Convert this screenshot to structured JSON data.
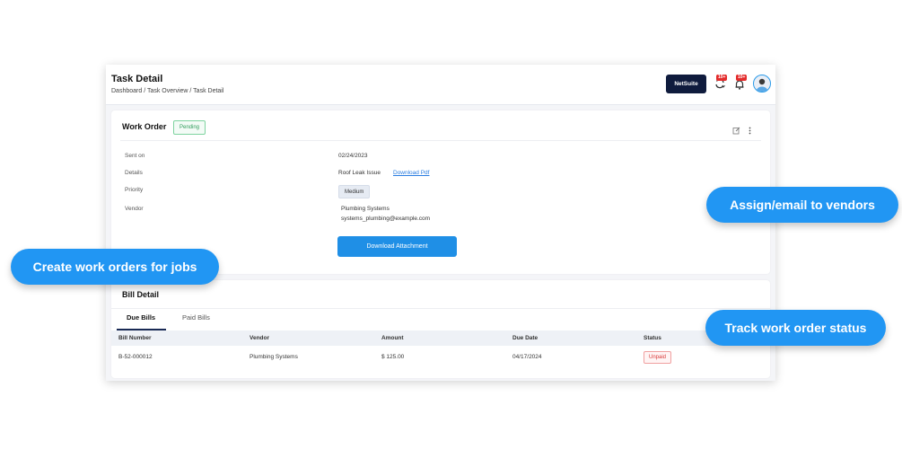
{
  "header": {
    "title": "Task Detail",
    "breadcrumb": "Dashboard / Task Overview / Task Detail",
    "netsuite_label": "NetSuite",
    "sync_badge": "10+",
    "notification_badge": "10+"
  },
  "work_order": {
    "title": "Work Order",
    "status": "Pending",
    "fields": {
      "sent_on_label": "Sent on",
      "sent_on_value": "02/24/2023",
      "details_label": "Details",
      "details_value": "Roof Leak Issue",
      "download_pdf_label": "Download Pdf",
      "priority_label": "Priority",
      "priority_value": "Medium",
      "vendor_label": "Vendor",
      "vendor_name": "Plumbing Systems",
      "vendor_email": "systems_plumbing@example.com"
    },
    "download_attachment_label": "Download Attachment"
  },
  "bill_detail": {
    "title": "Bill Detail",
    "tabs": [
      {
        "label": "Due Bills",
        "active": true
      },
      {
        "label": "Paid Bills",
        "active": false
      }
    ],
    "columns": [
      "Bill Number",
      "Vendor",
      "Amount",
      "Due Date",
      "Status"
    ],
    "rows": [
      {
        "bill_number": "B-52-000012",
        "vendor": "Plumbing Systems",
        "amount": "$ 125.00",
        "due_date": "04/17/2024",
        "status": "Unpaid"
      }
    ]
  },
  "callouts": {
    "create": "Create work orders for jobs",
    "assign": "Assign/email to vendors",
    "track": "Track work order status"
  },
  "icons": {
    "edit": "edit-icon",
    "more": "more-vertical-icon",
    "sync": "sync-icon",
    "bell": "bell-icon"
  },
  "colors": {
    "primary": "#1f8fe6",
    "callout": "#2196f3",
    "netsuite": "#0f1b3d",
    "pending": "#2f9c5b",
    "unpaid": "#d83a3a",
    "badge": "#e32b2b"
  }
}
